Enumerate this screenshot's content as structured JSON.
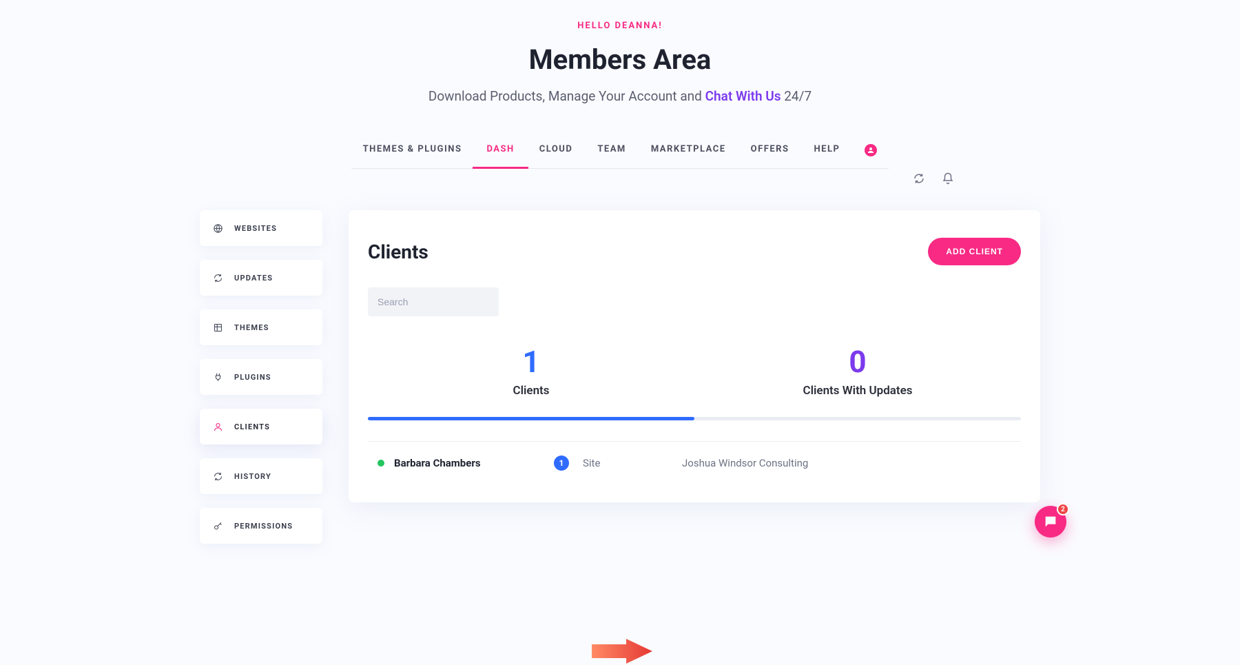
{
  "header": {
    "greeting": "HELLO DEANNA!",
    "title": "Members Area",
    "subtitle_before": "Download Products, Manage Your Account and ",
    "subtitle_link": "Chat With Us",
    "subtitle_after": " 24/7"
  },
  "topnav": {
    "tabs": [
      {
        "label": "THEMES & PLUGINS",
        "active": false
      },
      {
        "label": "DASH",
        "active": true
      },
      {
        "label": "CLOUD",
        "active": false
      },
      {
        "label": "TEAM",
        "active": false
      },
      {
        "label": "MARKETPLACE",
        "active": false
      },
      {
        "label": "OFFERS",
        "active": false
      },
      {
        "label": "HELP",
        "active": false
      }
    ]
  },
  "sidebar": {
    "items": [
      {
        "icon": "globe-icon",
        "label": "WEBSITES"
      },
      {
        "icon": "refresh-icon",
        "label": "UPDATES"
      },
      {
        "icon": "grid-icon",
        "label": "THEMES"
      },
      {
        "icon": "plug-icon",
        "label": "PLUGINS"
      },
      {
        "icon": "user-icon",
        "label": "CLIENTS"
      },
      {
        "icon": "history-icon",
        "label": "HISTORY"
      },
      {
        "icon": "key-icon",
        "label": "PERMISSIONS"
      }
    ],
    "active_index": 4
  },
  "card": {
    "title": "Clients",
    "add_button": "ADD CLIENT",
    "search_placeholder": "Search",
    "stats": [
      {
        "value": "1",
        "label": "Clients",
        "color": "blue",
        "active": true
      },
      {
        "value": "0",
        "label": "Clients With Updates",
        "color": "purple",
        "active": false
      }
    ],
    "client": {
      "name": "Barbara Chambers",
      "site_count": "1",
      "site_label": "Site",
      "site_name": "Joshua Windsor Consulting"
    }
  },
  "chat": {
    "badge": "2"
  }
}
